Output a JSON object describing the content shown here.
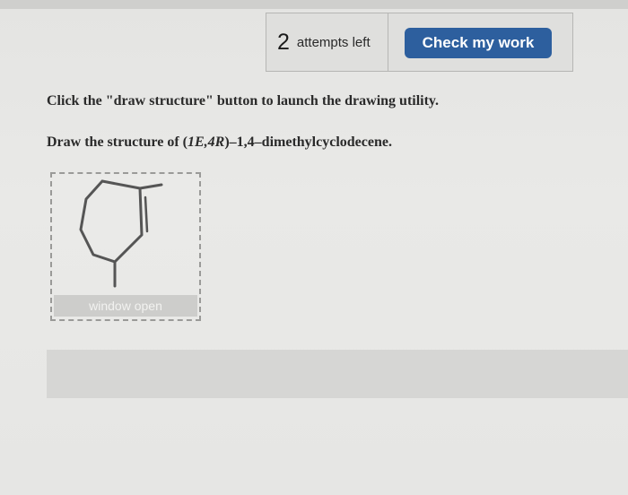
{
  "header": {
    "attempts_count": "2",
    "attempts_label": "attempts left",
    "check_button_label": "Check my work"
  },
  "content": {
    "instruction_text": "Click the \"draw structure\" button to launch the drawing utility.",
    "question_prefix": "Draw the structure of (",
    "question_stereo": "1E,4R",
    "question_suffix": ")–1,4–dimethylcyclodecene.",
    "window_open_label": "window open"
  },
  "colors": {
    "check_button_bg": "#2d5f9e",
    "page_bg": "#e6e6e4"
  }
}
